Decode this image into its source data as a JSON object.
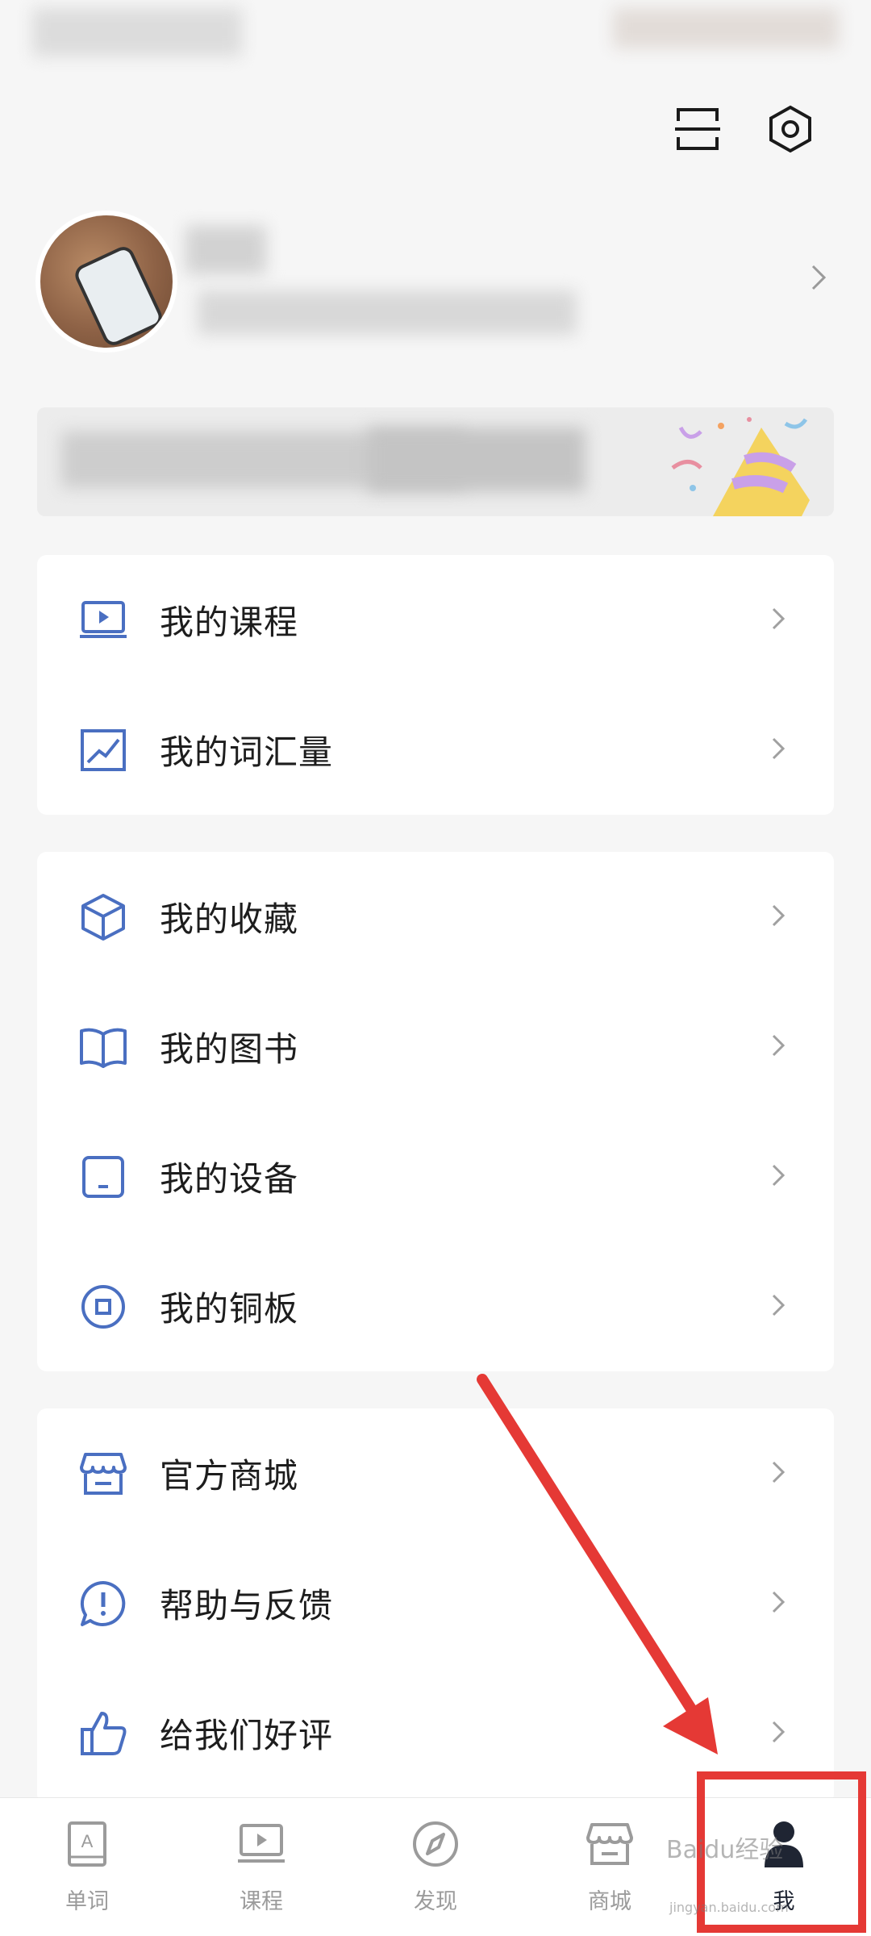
{
  "header": {
    "scan_icon": "scan-icon",
    "settings_icon": "settings-icon"
  },
  "menu_group_1": [
    {
      "label": "我的课程",
      "icon": "course-screen-icon"
    },
    {
      "label": "我的词汇量",
      "icon": "vocabulary-chart-icon"
    }
  ],
  "menu_group_2": [
    {
      "label": "我的收藏",
      "icon": "collection-box-icon"
    },
    {
      "label": "我的图书",
      "icon": "book-icon"
    },
    {
      "label": "我的设备",
      "icon": "device-icon"
    },
    {
      "label": "我的铜板",
      "icon": "coin-icon"
    }
  ],
  "menu_group_3": [
    {
      "label": "官方商城",
      "icon": "store-icon"
    },
    {
      "label": "帮助与反馈",
      "icon": "help-feedback-icon"
    },
    {
      "label": "给我们好评",
      "icon": "thumbs-up-icon"
    }
  ],
  "tabs": [
    {
      "label": "单词",
      "icon": "word-book-icon",
      "active": false
    },
    {
      "label": "课程",
      "icon": "course-icon",
      "active": false
    },
    {
      "label": "发现",
      "icon": "compass-icon",
      "active": false
    },
    {
      "label": "商城",
      "icon": "shop-icon",
      "active": false
    },
    {
      "label": "我",
      "icon": "person-icon",
      "active": true
    }
  ],
  "watermark": {
    "brand": "Baidu经验",
    "url": "jingyan.baidu.com"
  },
  "colors": {
    "accent": "#4a6fc1",
    "highlight": "#e53935",
    "tab_active": "#1f2533",
    "tab_inactive": "#9b9b9b"
  }
}
